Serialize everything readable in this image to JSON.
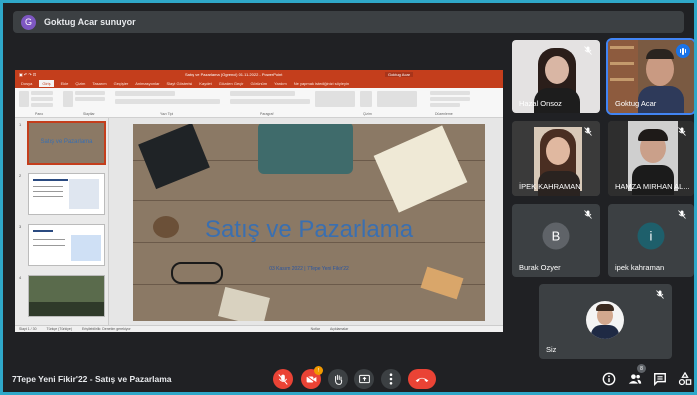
{
  "presenter": {
    "initial": "G",
    "text": "Goktug Acar sunuyor"
  },
  "shared_screen": {
    "window_title": "Satış ve Pazarlama (Ogrenci) 01.11.2022 - PowerPoint",
    "account": "Goktug Acar",
    "tabs": [
      "Dosya",
      "Giriş",
      "Ekle",
      "Çizim",
      "Tasarım",
      "Geçişler",
      "Animasyonlar",
      "Slayt Gösterisi",
      "Kaydet",
      "Gözden Geçir",
      "Görünüm",
      "Yardım",
      "Ne yapmak istediğinizi söyleyin"
    ],
    "active_tab": "Giriş",
    "ribbon_groups": [
      "Pano",
      "Slaytlar",
      "Yazı Tipi",
      "Paragraf",
      "Çizim",
      "Düzenleme"
    ],
    "slide_numbers": [
      "1",
      "2",
      "3",
      "4"
    ],
    "slide_title": "Satış ve Pazarlama",
    "slide_subtitle": "03 Kasım 2022 | 7Tepe Yeni Fikir'22",
    "status": [
      "Slayt 1 / 30",
      "Türkçe (Türkiye)",
      "Erişilebilirlik: Denetim gerekiyor",
      "Notlar",
      "Açıklamalar"
    ]
  },
  "participants": [
    {
      "name": "Hazal Onsoz"
    },
    {
      "name": "Goktug Acar"
    },
    {
      "name": "İPEK KAHRAMAN"
    },
    {
      "name": "HAMZA MIRHAN AL..."
    },
    {
      "name": "Burak Ozyer",
      "initial": "B"
    },
    {
      "name": "ipek kahraman",
      "initial": "i"
    },
    {
      "name": "Siz"
    }
  ],
  "meeting": {
    "title": "7Tepe Yeni Fikir'22 - Satış ve Pazarlama",
    "participant_count": "8",
    "cam_badge": "!"
  },
  "colors": {
    "accent": "#1a73e8",
    "danger": "#ea4335",
    "surface": "#3c4043",
    "background": "#202124",
    "frame": "#2fa8c9",
    "powerpoint": "#c43e1c"
  },
  "icons": [
    "mic-off-icon",
    "camera-off-icon",
    "raise-hand-icon",
    "present-screen-icon",
    "more-options-icon",
    "hang-up-icon",
    "info-icon",
    "people-icon",
    "chat-icon",
    "activities-icon",
    "speaking-indicator-icon"
  ]
}
